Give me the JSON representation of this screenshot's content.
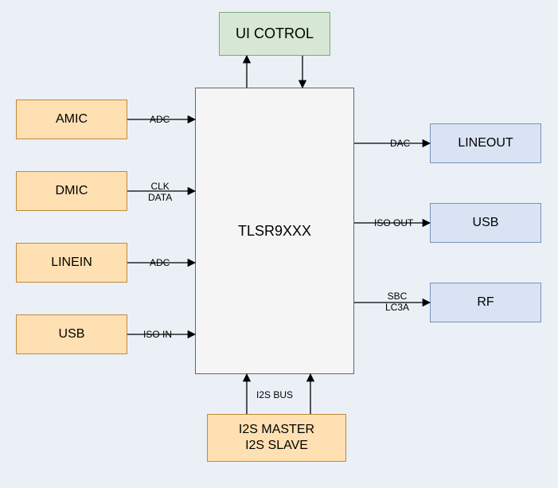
{
  "blocks": {
    "ui_control": "UI COTROL",
    "center": "TLSR9XXX",
    "amic": "AMIC",
    "dmic": "DMIC",
    "linein": "LINEIN",
    "usb_in": "USB",
    "i2s": "I2S MASTER\nI2S SLAVE",
    "lineout": "LINEOUT",
    "usb_out": "USB",
    "rf": "RF"
  },
  "labels": {
    "amic_adc": "ADC",
    "dmic": "CLK\nDATA",
    "linein_adc": "ADC",
    "usb_iso_in": "ISO IN",
    "i2s_bus": "I2S BUS",
    "dac": "DAC",
    "iso_out": "ISO OUT",
    "sbc": "SBC\nLC3A"
  }
}
